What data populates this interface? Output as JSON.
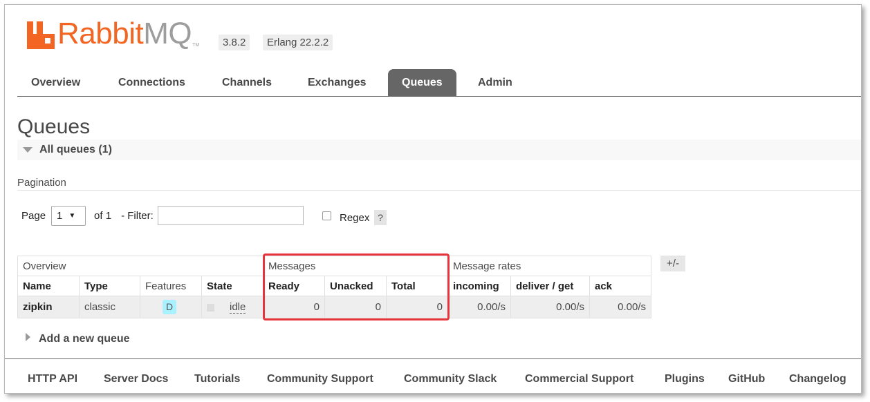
{
  "header": {
    "logo_rabbit": "Rabbit",
    "logo_mq": "MQ",
    "logo_tm": "TM",
    "version": "3.8.2",
    "erlang": "Erlang 22.2.2",
    "brand_color": "#f26522"
  },
  "nav": {
    "tabs": [
      "Overview",
      "Connections",
      "Channels",
      "Exchanges",
      "Queues",
      "Admin"
    ],
    "active": "Queues"
  },
  "page": {
    "title": "Queues",
    "section": "All queues (1)",
    "pagination_label": "Pagination"
  },
  "pager": {
    "page_label": "Page",
    "page_value": "1",
    "of_label": "of 1",
    "filter_label": "- Filter:",
    "filter_value": "",
    "regex_label": "Regex",
    "help_label": "?"
  },
  "table": {
    "groups": [
      "Overview",
      "Messages",
      "Message rates"
    ],
    "plus_minus": "+/-",
    "columns": [
      "Name",
      "Type",
      "Features",
      "State",
      "Ready",
      "Unacked",
      "Total",
      "incoming",
      "deliver / get",
      "ack"
    ],
    "rows": [
      {
        "name": "zipkin",
        "type": "classic",
        "features": "D",
        "state": "idle",
        "ready": "0",
        "unacked": "0",
        "total": "0",
        "incoming": "0.00/s",
        "deliver_get": "0.00/s",
        "ack": "0.00/s"
      }
    ],
    "highlight_color": "#e8323c"
  },
  "add_queue": "Add a new queue",
  "footer": {
    "links": [
      "HTTP API",
      "Server Docs",
      "Tutorials",
      "Community Support",
      "Community Slack",
      "Commercial Support",
      "Plugins",
      "GitHub",
      "Changelog"
    ]
  }
}
